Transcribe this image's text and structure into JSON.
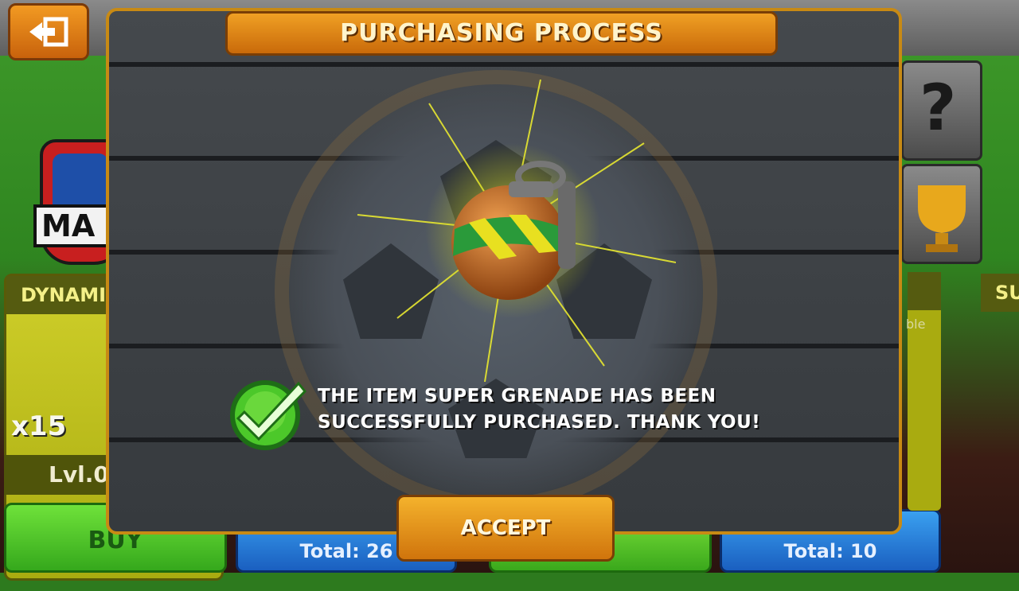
{
  "dialog": {
    "title": "PURCHASING PROCESS",
    "message": "THE ITEM SUPER GRENADE HAS BEEN SUCCESSFULLY PURCHASED. THANK YOU!",
    "accept_label": "ACCEPT",
    "item_icon": "grenade-icon",
    "status_icon": "check-icon"
  },
  "background": {
    "card_left": {
      "header": "DYNAMIT",
      "count": "x15",
      "level": "Lvl.0",
      "buy_label": "BUY"
    },
    "card_right_header": "SU",
    "partial_text": "ble",
    "totals": [
      "Total: 26",
      "",
      "Total: 10"
    ],
    "logo_text": "MA"
  },
  "colors": {
    "accent_orange": "#e8901a",
    "check_green": "#4cc82a",
    "dialog_border": "#c88a14"
  }
}
